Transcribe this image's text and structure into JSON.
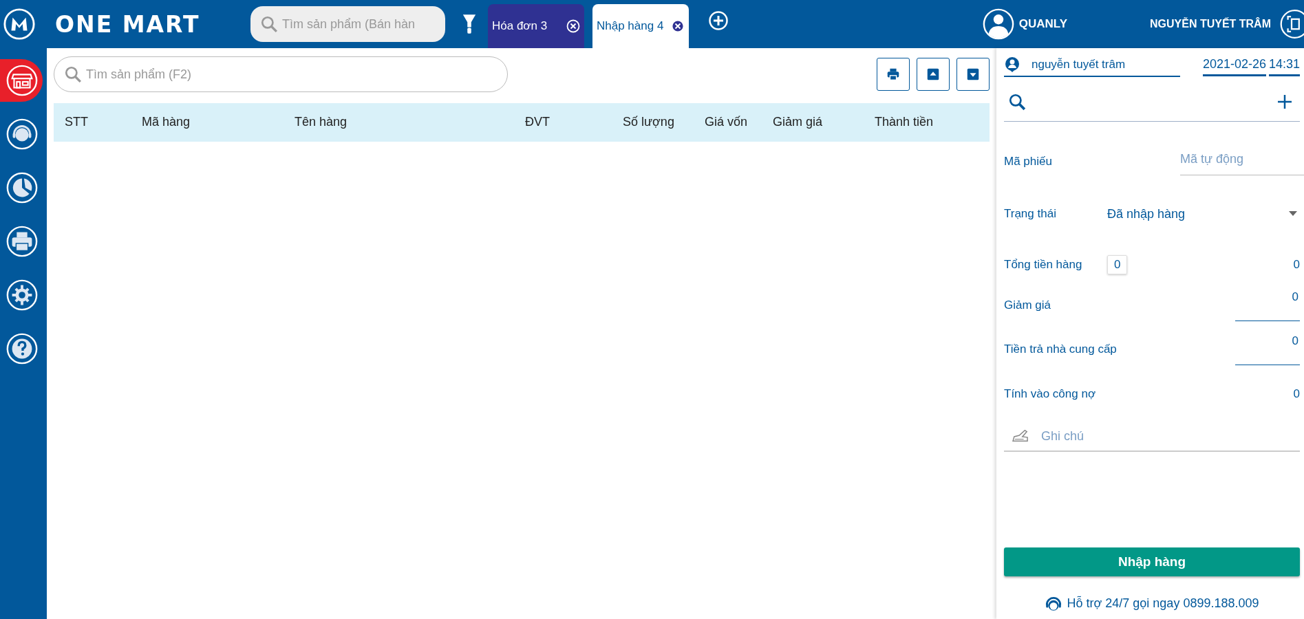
{
  "app": {
    "logo_text": "ONE MART"
  },
  "top_search": {
    "placeholder": "Tìm sản phẩm (Bán hàn"
  },
  "tabs": [
    {
      "label": "Hóa đơn 3",
      "selected": false
    },
    {
      "label": "Nhập hàng 4",
      "selected": true
    }
  ],
  "user": {
    "role": "QUANLY",
    "name": "NGUYỄN TUYẾT TRÂM"
  },
  "sidebar": {
    "items": [
      {
        "kind": "store",
        "selected": true
      },
      {
        "kind": "support",
        "selected": false
      },
      {
        "kind": "chart",
        "selected": false
      },
      {
        "kind": "printer",
        "selected": false
      },
      {
        "kind": "settings",
        "selected": false
      },
      {
        "kind": "help",
        "selected": false
      }
    ]
  },
  "search": {
    "placeholder": "Tìm sản phẩm (F2)"
  },
  "table": {
    "columns": [
      "STT",
      "Mã hàng",
      "Tên hàng",
      "ĐVT",
      "Số lượng",
      "Giá vốn",
      "Giảm giá",
      "Thành tiền"
    ]
  },
  "panel": {
    "staff": "nguyễn tuyết trâm",
    "date": "2021-02-26",
    "time": "14:31",
    "fields": [
      {
        "kind": "input",
        "label": "Mã phiếu",
        "placeholder": "Mã tự động"
      },
      {
        "kind": "select",
        "label": "Trạng thái",
        "value": "Đã nhập hàng"
      },
      {
        "kind": "total",
        "label": "Tổng tiền hàng",
        "badge": "0",
        "value": "0"
      },
      {
        "kind": "underlined",
        "label": "Giảm giá",
        "value": "0"
      },
      {
        "kind": "underlined",
        "label": "Tiền trả nhà cung cấp",
        "value": "0"
      },
      {
        "kind": "plain",
        "label": "Tính vào công nợ",
        "value": "0"
      }
    ],
    "note_placeholder": "Ghi chú",
    "submit": "Nhập hàng",
    "support": "Hỗ trợ 24/7 gọi ngay 0899.188.009"
  }
}
